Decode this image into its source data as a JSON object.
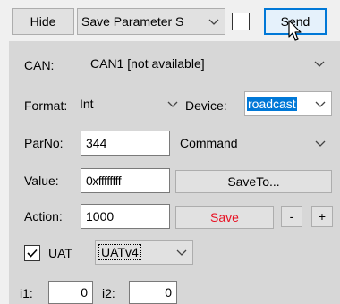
{
  "toolbar": {
    "hide_label": "Hide",
    "preset_value": "Save Parameter S",
    "send_label": "Send"
  },
  "can": {
    "label": "CAN:",
    "value": "CAN1  [not available]"
  },
  "format": {
    "label": "Format:",
    "value": "Int"
  },
  "device": {
    "label": "Device:",
    "value": "roadcast"
  },
  "parno": {
    "label": "ParNo:",
    "value": "344",
    "mode_value": "Command"
  },
  "value": {
    "label": "Value:",
    "value": "0xffffffff",
    "saveto_label": "SaveTo..."
  },
  "action": {
    "label": "Action:",
    "value": "1000",
    "save_label": "Save",
    "minus_label": "-",
    "plus_label": "+"
  },
  "uat": {
    "label": "UAT",
    "checked": true,
    "version_value": "UATv4"
  },
  "indices": {
    "i1_label": "i1:",
    "i1_value": "0",
    "i2_label": "i2:",
    "i2_value": "0"
  },
  "colors": {
    "accent": "#0078d7",
    "danger": "#e81123",
    "panel": "#d7d7d7"
  },
  "icons": [
    "chevron-down-icon",
    "check-icon",
    "mouse-pointer-icon"
  ]
}
